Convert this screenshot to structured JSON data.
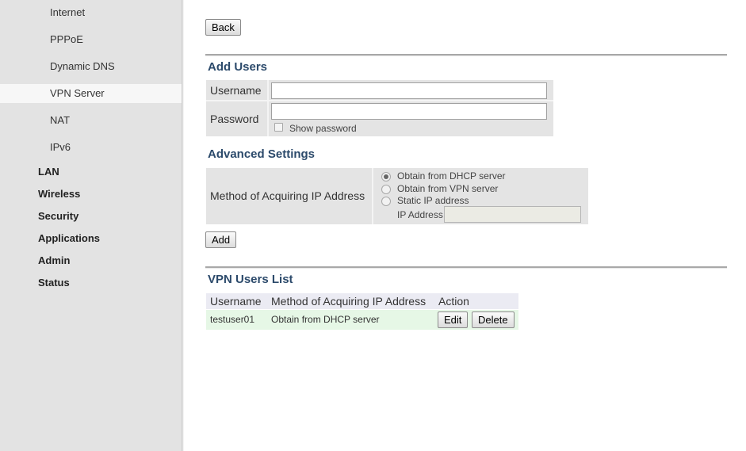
{
  "sidebar": {
    "sub_items": [
      {
        "label": "Internet",
        "active": false
      },
      {
        "label": "PPPoE",
        "active": false
      },
      {
        "label": "Dynamic DNS",
        "active": false
      },
      {
        "label": "VPN Server",
        "active": true
      },
      {
        "label": "NAT",
        "active": false
      },
      {
        "label": "IPv6",
        "active": false
      }
    ],
    "main_items": [
      "LAN",
      "Wireless",
      "Security",
      "Applications",
      "Admin",
      "Status"
    ]
  },
  "toolbar": {
    "back_label": "Back"
  },
  "add_users": {
    "title": "Add Users",
    "username_label": "Username",
    "username_value": "",
    "password_label": "Password",
    "password_value": "",
    "show_password_label": "Show password",
    "show_password_checked": false
  },
  "advanced": {
    "title": "Advanced Settings",
    "method_label": "Method of Acquiring IP Address",
    "options": [
      {
        "label": "Obtain from DHCP server",
        "selected": true
      },
      {
        "label": "Obtain from VPN server",
        "selected": false
      },
      {
        "label": "Static IP address",
        "selected": false
      }
    ],
    "ip_address_label": "IP Address",
    "ip_address_value": "",
    "add_label": "Add"
  },
  "vpn_users_list": {
    "title": "VPN Users List",
    "columns": [
      "Username",
      "Method of Acquiring IP Address",
      "Action"
    ],
    "rows": [
      {
        "username": "testuser01",
        "method": "Obtain from DHCP server",
        "edit_label": "Edit",
        "delete_label": "Delete"
      }
    ]
  },
  "colors": {
    "sidebar_bg": "#e3e3e3",
    "section_title": "#2c4a6b",
    "form_bg": "#e4e4e4",
    "list_header_bg": "#ebebf3",
    "list_row_bg": "#e6f7e6"
  }
}
